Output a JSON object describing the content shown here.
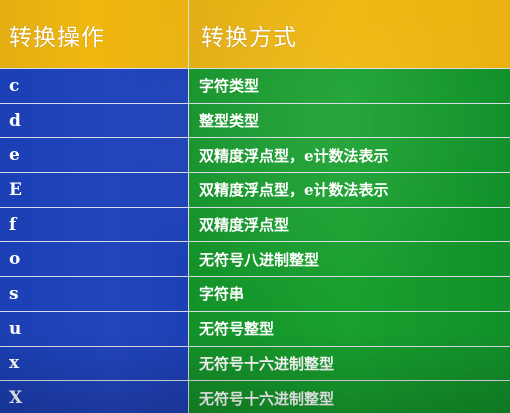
{
  "header": {
    "col_operation": "转换操作",
    "col_method": "转换方式"
  },
  "rows": [
    {
      "op": "c",
      "desc": "字符类型"
    },
    {
      "op": "d",
      "desc": "整型类型"
    },
    {
      "op": "e",
      "desc": "双精度浮点型，e计数法表示"
    },
    {
      "op": "E",
      "desc": "双精度浮点型，e计数法表示"
    },
    {
      "op": "f",
      "desc": "双精度浮点型"
    },
    {
      "op": "o",
      "desc": "无符号八进制整型"
    },
    {
      "op": "s",
      "desc": "字符串"
    },
    {
      "op": "u",
      "desc": "无符号整型"
    },
    {
      "op": "x",
      "desc": "无符号十六进制整型"
    },
    {
      "op": "X",
      "desc": "无符号十六进制整型"
    }
  ],
  "colors": {
    "header_bg": "#f0b80e",
    "operation_bg": "#2245be",
    "method_bg": "#18a02e",
    "text": "#ffffff",
    "grid": "#d8dce8"
  }
}
